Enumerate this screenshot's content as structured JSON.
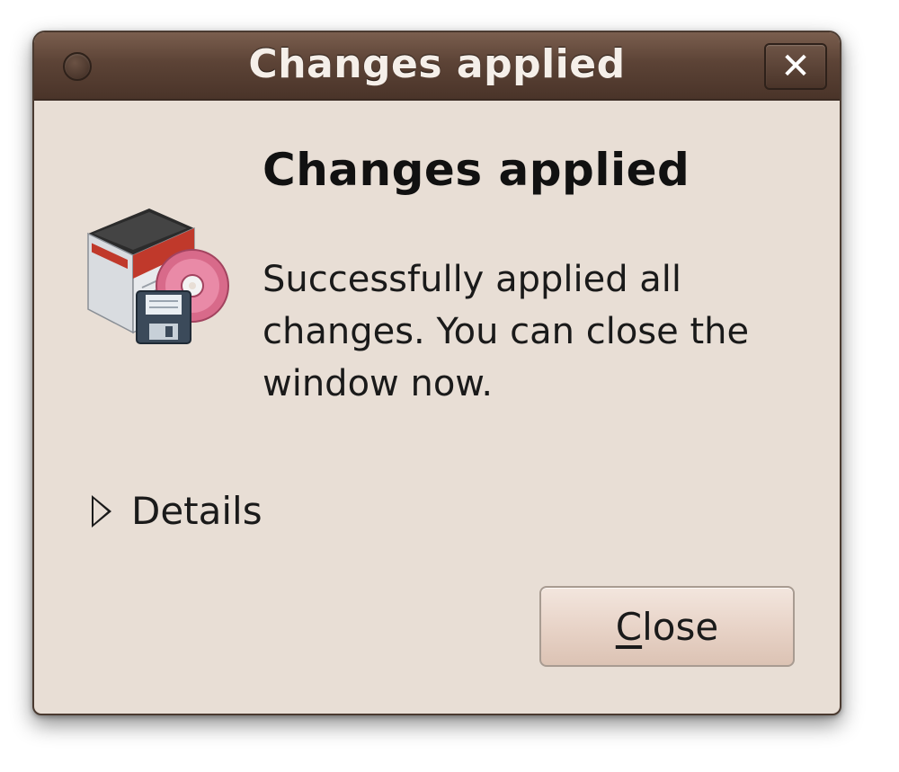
{
  "window": {
    "title": "Changes applied"
  },
  "dialog": {
    "heading": "Changes applied",
    "message": "Successfully applied all changes. You can close the window now.",
    "details_label": "Details",
    "close_button": {
      "mnemonic": "C",
      "rest": "lose"
    },
    "icon": "package-installer-icon"
  },
  "colors": {
    "titlebar": "#5c4336",
    "dialog_bg": "#e8ded5",
    "button_bg": "#e7d2c6"
  }
}
